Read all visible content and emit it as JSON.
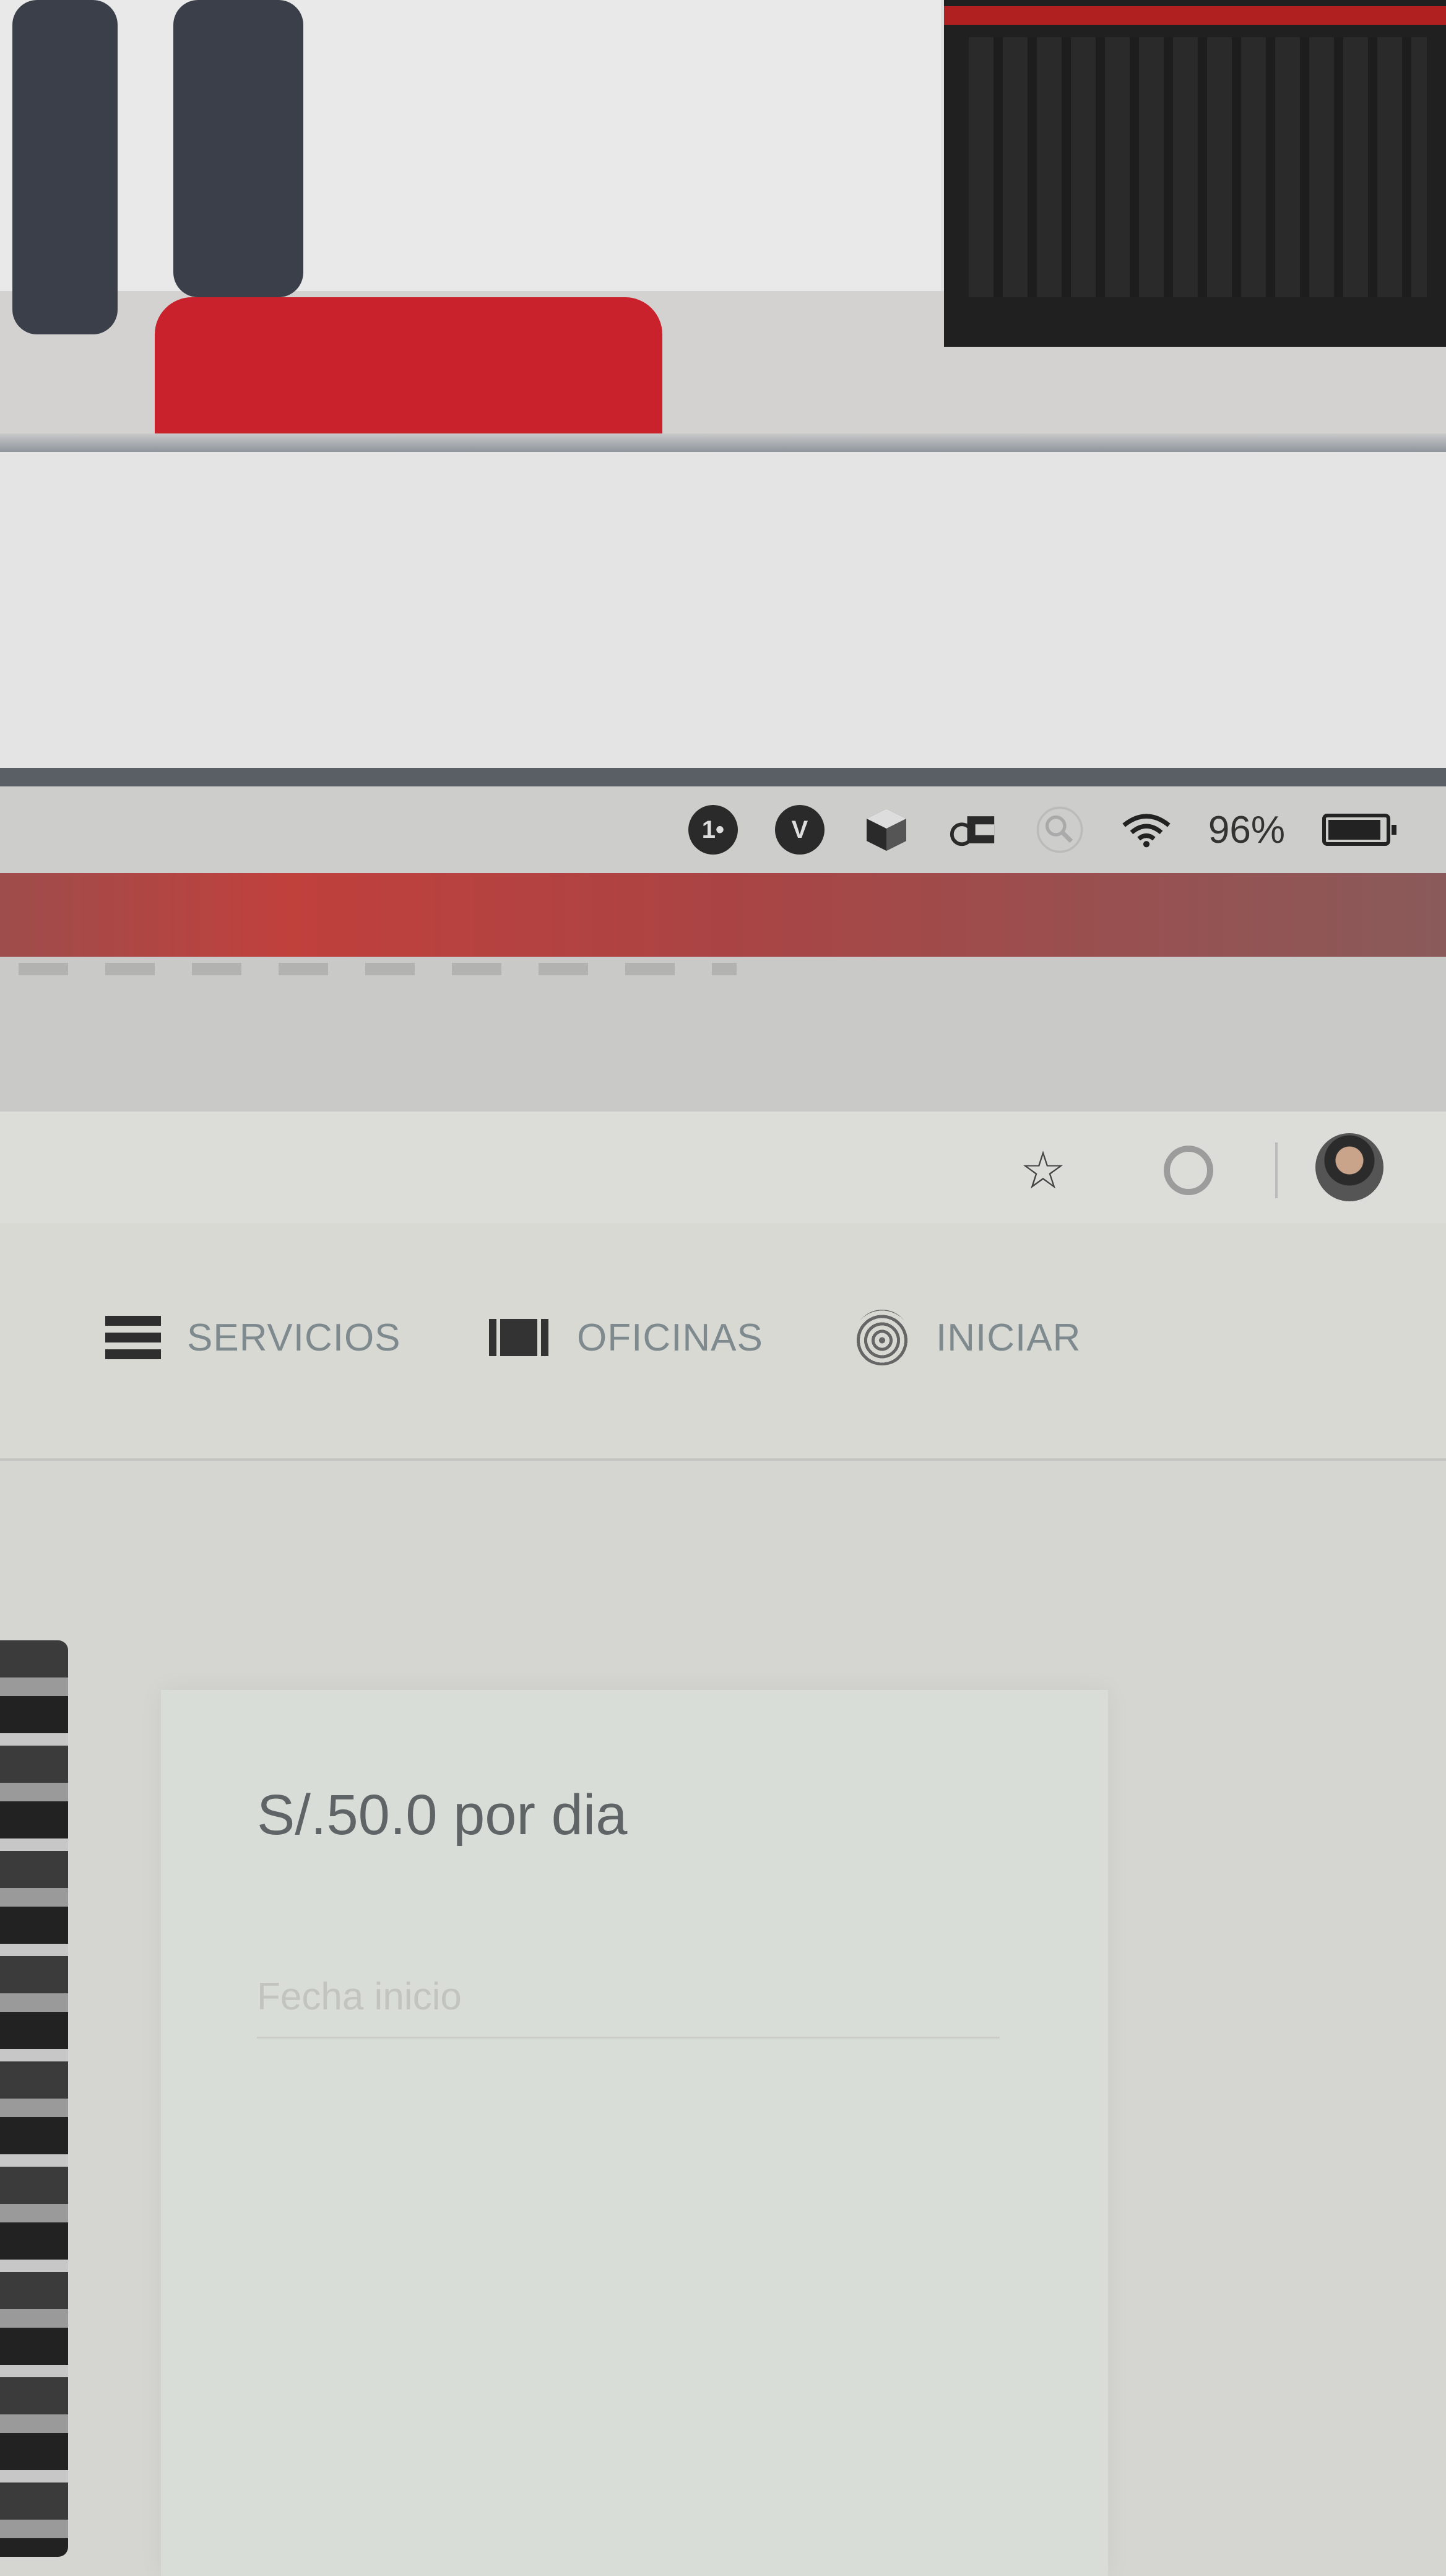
{
  "menubar": {
    "tray_icons": [
      "one-password-icon",
      "v-icon",
      "box-icon",
      "creative-cloud-icon",
      "search-icon",
      "wifi-icon"
    ],
    "tray_v_glyph": "V",
    "tray_1p_glyph": "1•",
    "battery_percent": "96%"
  },
  "browser": {
    "bookmark_glyph": "☆"
  },
  "nav": {
    "items": [
      {
        "label": "SERVICIOS",
        "icon": "list-icon"
      },
      {
        "label": "OFICINAS",
        "icon": "building-icon"
      },
      {
        "label": "INICIAR",
        "icon": "fingerprint-icon"
      }
    ]
  },
  "card": {
    "price": "S/.50.0 por dia",
    "start_date_label": "Fecha inicio"
  },
  "colors": {
    "accent_red": "#c0403c",
    "nav_text": "#7f8a8f"
  }
}
